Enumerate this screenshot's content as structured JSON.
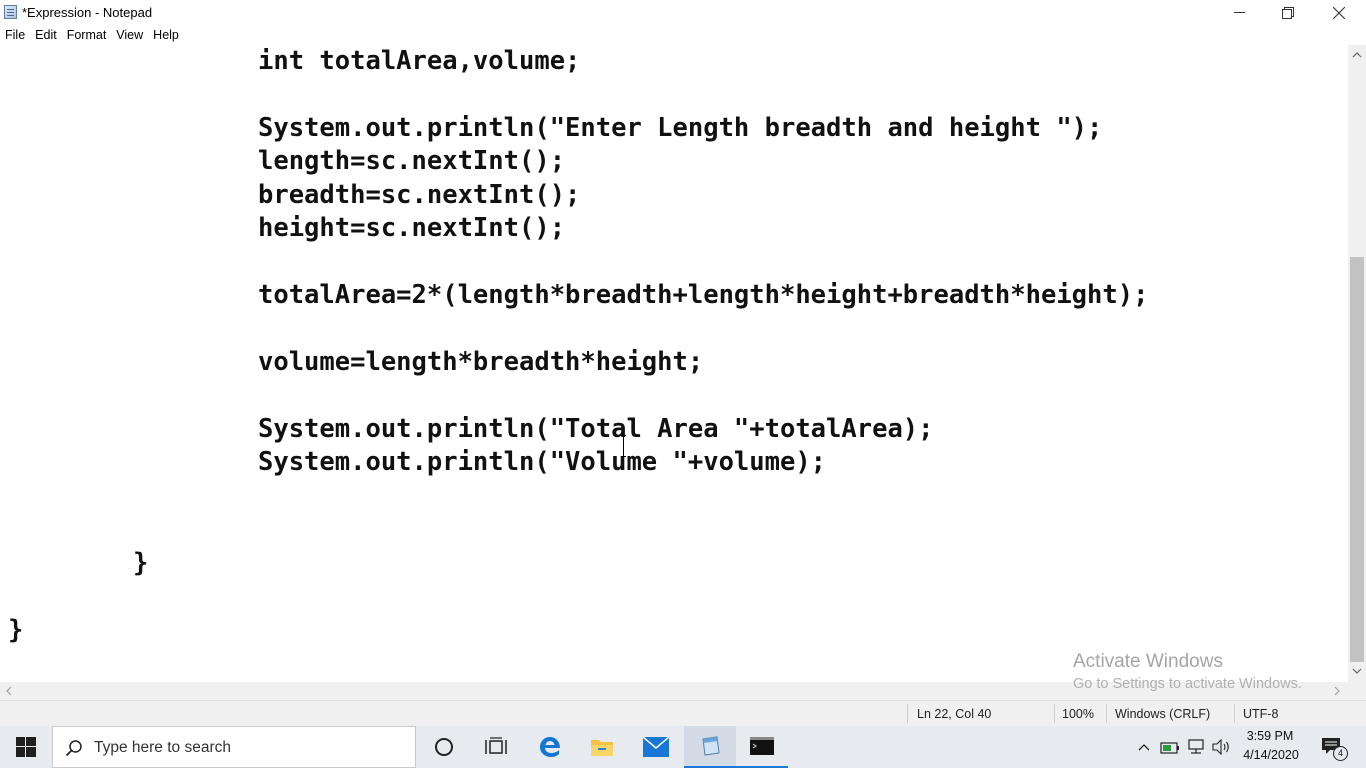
{
  "window": {
    "title": "*Expression - Notepad"
  },
  "menu": [
    "File",
    "Edit",
    "Format",
    "View",
    "Help"
  ],
  "code_lines": [
    "int totalArea,volume;",
    "System.out.println(\"Enter Length breadth and height \");",
    "length=sc.nextInt();",
    "breadth=sc.nextInt();",
    "height=sc.nextInt();",
    "totalArea=2*(length*breadth+length*height+breadth*height);",
    "volume=length*breadth*height;",
    "System.out.println(\"Total Area \"+totalArea);",
    "System.out.println(\"Volume \"+volume);",
    "}",
    "}"
  ],
  "watermark": {
    "line1": "Activate Windows",
    "line2": "Go to Settings to activate Windows."
  },
  "status": {
    "position": "Ln 22, Col 40",
    "zoom": "100%",
    "line_ending": "Windows (CRLF)",
    "encoding": "UTF-8"
  },
  "taskbar": {
    "search_placeholder": "Type here to search",
    "icons": [
      "cortana-icon",
      "task-view-icon",
      "edge-icon",
      "file-explorer-icon",
      "mail-icon",
      "notepad-icon",
      "cmd-icon"
    ],
    "clock_time": "3:59 PM",
    "clock_date": "4/14/2020",
    "notification_count": "4"
  }
}
